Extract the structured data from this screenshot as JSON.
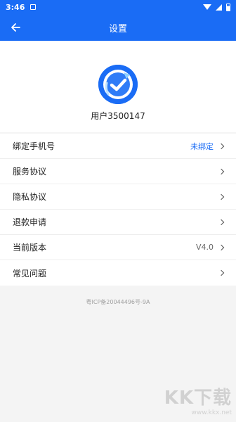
{
  "status": {
    "time": "3:46"
  },
  "header": {
    "title": "设置"
  },
  "profile": {
    "username": "用户3500147"
  },
  "menu": [
    {
      "label": "绑定手机号",
      "value": "未绑定"
    },
    {
      "label": "服务协议"
    },
    {
      "label": "隐私协议"
    },
    {
      "label": "退款申请"
    },
    {
      "label": "当前版本",
      "value": "V4.0"
    },
    {
      "label": "常见问题"
    }
  ],
  "footer": {
    "icp": "粤ICP备20044496号-9A"
  },
  "watermark": {
    "logo": "KK下载",
    "url": "www.kkx.net"
  },
  "colors": {
    "accent": "#1a6cf5",
    "background": "#f4f4f4"
  }
}
